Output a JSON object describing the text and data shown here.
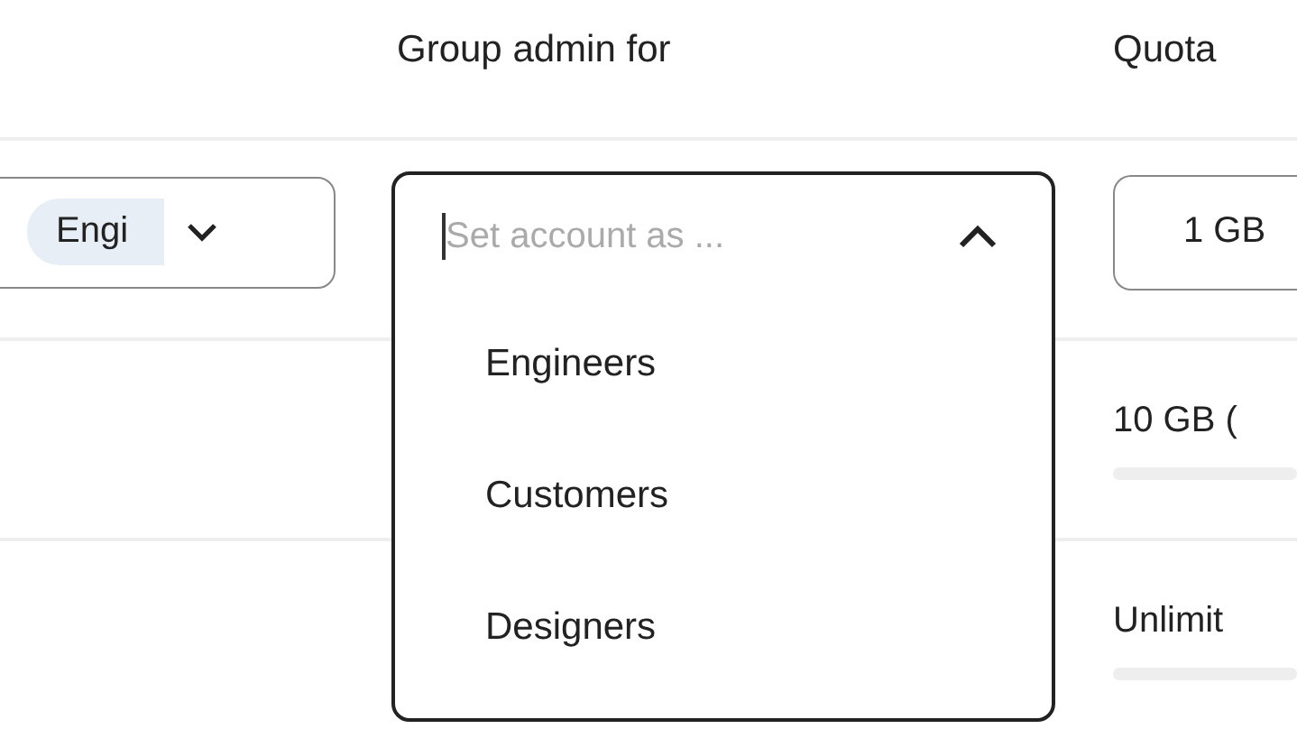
{
  "headers": [
    "Group admin for",
    "Quota"
  ],
  "rows": [
    {
      "kind": "select",
      "groups": {
        "chip": "Engi",
        "expanded": false
      },
      "quota": "1 GB"
    },
    {
      "kind": "usage",
      "quota": "10 GB (",
      "level": 0
    },
    {
      "kind": "usage",
      "quota": "Unlimit",
      "level": 0
    }
  ],
  "admin_dropdown": {
    "placeholder": "Set account as ...",
    "expanded": true,
    "options": [
      {
        "label": "Engineers",
        "selected": false
      },
      {
        "label": "Customers",
        "selected": false
      },
      {
        "label": "Designers",
        "selected": false
      }
    ]
  }
}
